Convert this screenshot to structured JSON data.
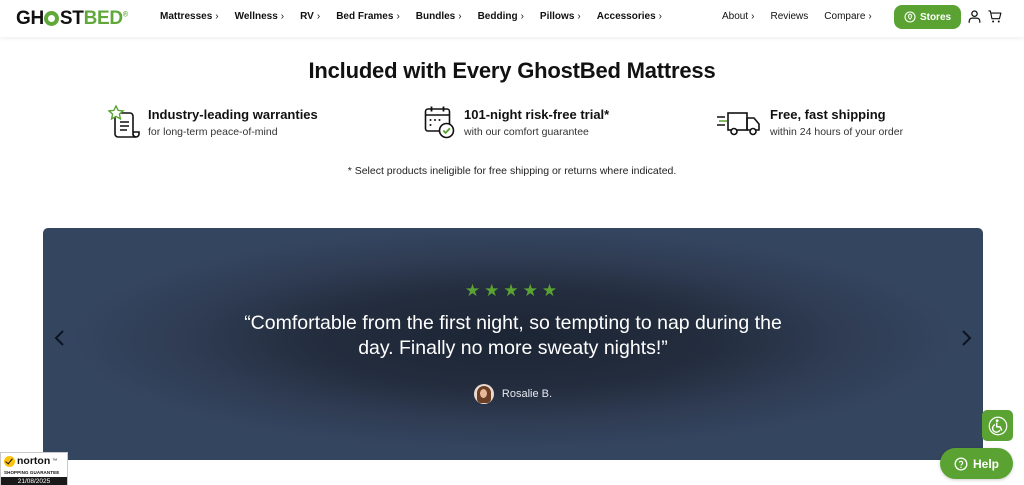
{
  "header": {
    "logo": {
      "text_ghost": "GH",
      "text_st": "ST",
      "text_bed": "BED",
      "reg": "®"
    },
    "nav_left": [
      {
        "label": "Mattresses",
        "chevron": "›"
      },
      {
        "label": "Wellness",
        "chevron": "›"
      },
      {
        "label": "RV",
        "chevron": "›"
      },
      {
        "label": "Bed Frames",
        "chevron": "›"
      },
      {
        "label": "Bundles",
        "chevron": "›"
      },
      {
        "label": "Bedding",
        "chevron": "›"
      },
      {
        "label": "Pillows",
        "chevron": "›"
      },
      {
        "label": "Accessories",
        "chevron": "›"
      }
    ],
    "nav_right": [
      {
        "label": "About",
        "chevron": "›"
      },
      {
        "label": "Reviews",
        "chevron": ""
      },
      {
        "label": "Compare",
        "chevron": "›"
      }
    ],
    "stores_label": "Stores",
    "icons": {
      "account": "user-icon",
      "cart": "cart-icon",
      "stores": "map-pin-icon"
    }
  },
  "section": {
    "title": "Included with Every GhostBed Mattress",
    "features": [
      {
        "icon": "warranty-certificate-icon",
        "title": "Industry-leading warranties",
        "subtitle": "for long-term peace-of-mind"
      },
      {
        "icon": "calendar-check-icon",
        "title": "101-night risk-free trial*",
        "subtitle": "with our comfort guarantee"
      },
      {
        "icon": "delivery-truck-icon",
        "title": "Free, fast shipping",
        "subtitle": "within 24 hours of your order"
      }
    ],
    "disclaimer": "* Select products ineligible for free shipping or returns where indicated."
  },
  "testimonial": {
    "stars": "★★★★★",
    "rating": 5,
    "quote": "“Comfortable from the first night, so tempting to nap during the day. Finally no more sweaty nights!”",
    "reviewer": "Rosalie B."
  },
  "widgets": {
    "help_label": "Help",
    "norton": {
      "brand": "norton",
      "tm": "™",
      "subtitle": "SHOPPING GUARANTEE",
      "date": "21/08/2025"
    }
  },
  "colors": {
    "brand_green": "#5aa333",
    "banner_navy": "#344560",
    "text_dark": "#111111"
  }
}
